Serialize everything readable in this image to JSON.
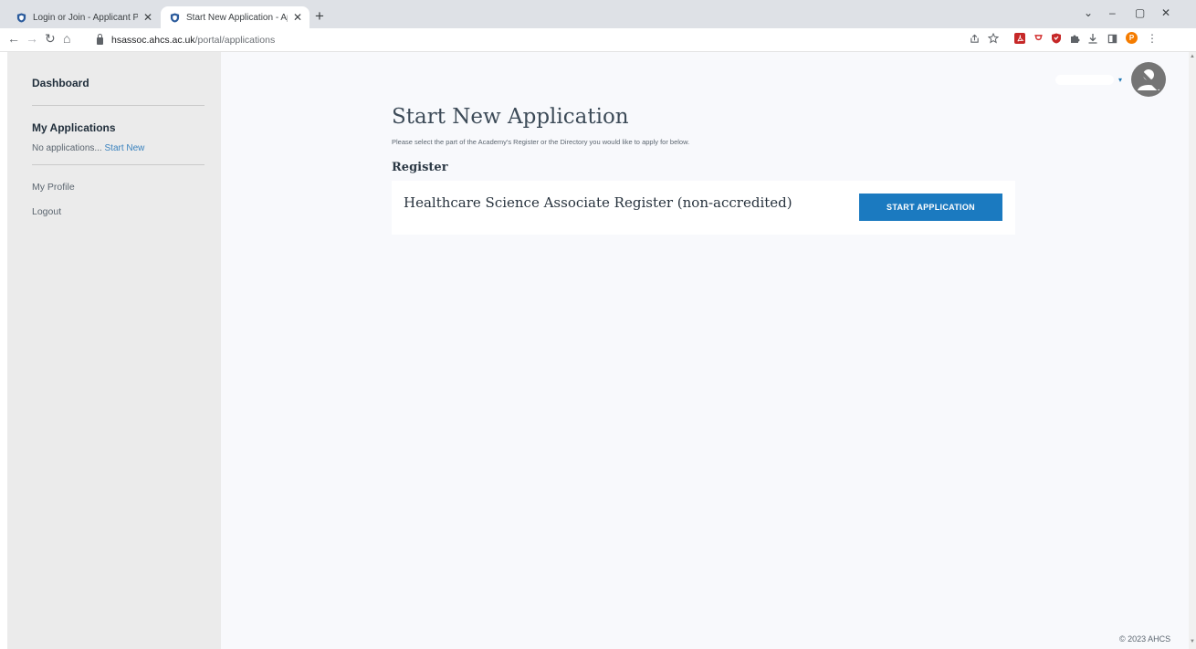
{
  "browser": {
    "tabs": [
      {
        "title": "Login or Join - Applicant Portal",
        "close": "✕"
      },
      {
        "title": "Start New Application - Applican",
        "close": "✕"
      }
    ],
    "new_tab": "+",
    "window_controls": {
      "tablist": "⌄",
      "minimize": "–",
      "maximize": "▢",
      "close": "✕"
    },
    "nav": {
      "back": "←",
      "forward": "→",
      "reload": "↻",
      "home": "⌂"
    },
    "url_host": "hsassoc.ahcs.ac.uk",
    "url_path": "/portal/applications",
    "menu_glyph": "⋮",
    "profile_initial": "P",
    "accent": "#1b7ac0"
  },
  "sidebar": {
    "dashboard": "Dashboard",
    "my_applications": "My Applications",
    "no_apps": "No applications... ",
    "start_new": "Start New",
    "my_profile": "My Profile",
    "logout": "Logout"
  },
  "header": {
    "caret": "▾"
  },
  "main": {
    "title": "Start New Application",
    "subtitle": "Please select the part of the Academy's Register or the Directory you would like to apply for below.",
    "section": "Register",
    "register_name": "Healthcare Science Associate Register (non-accredited)",
    "start_button": "START APPLICATION"
  },
  "footer": {
    "copyright": "© 2023 AHCS"
  }
}
